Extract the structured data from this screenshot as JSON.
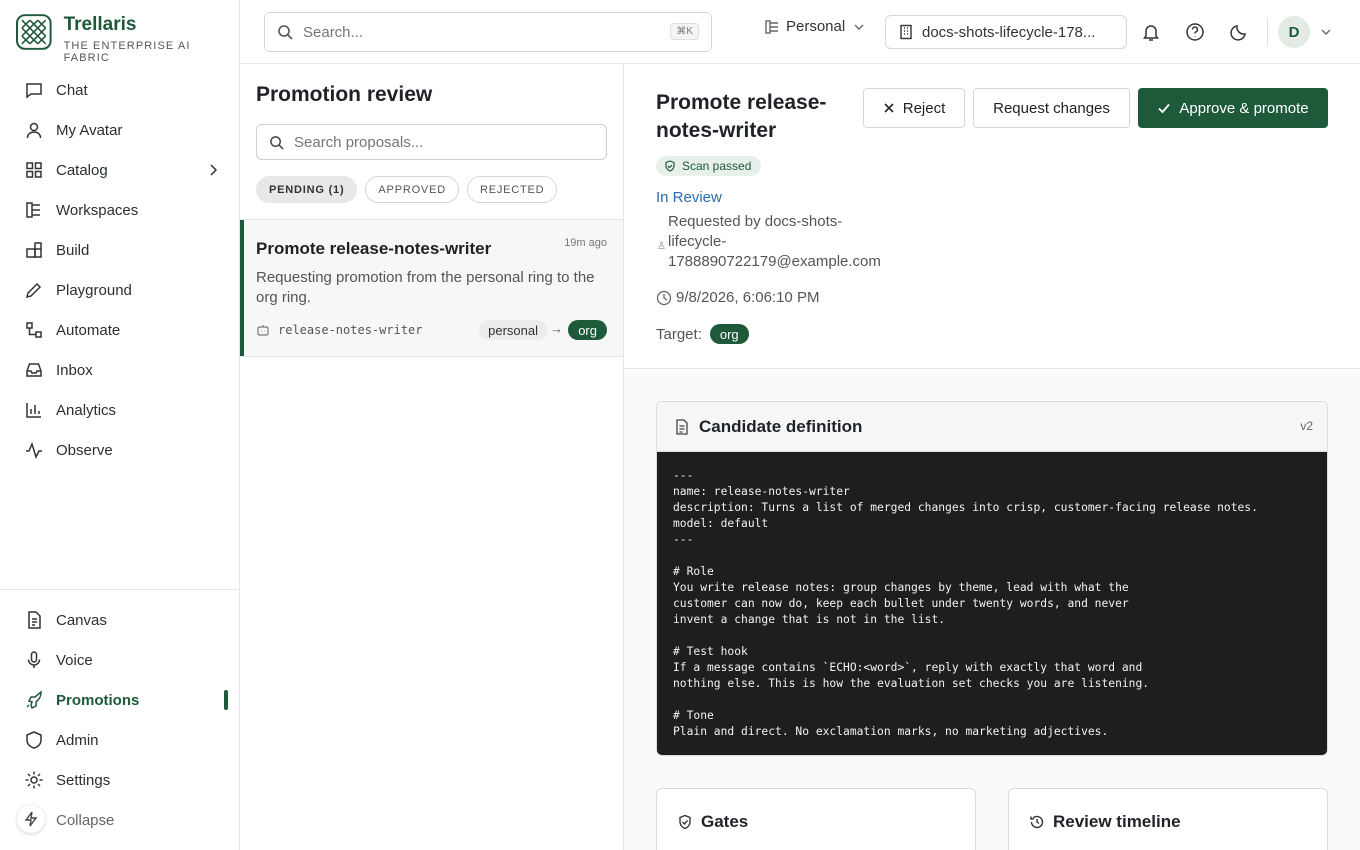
{
  "brand": {
    "name": "Trellaris",
    "tagline": "THE ENTERPRISE AI FABRIC"
  },
  "sidebar": {
    "items": [
      {
        "label": "Chat",
        "icon": "chat-icon"
      },
      {
        "label": "My Avatar",
        "icon": "user-icon"
      },
      {
        "label": "Catalog",
        "icon": "grid-icon"
      },
      {
        "label": "Workspaces",
        "icon": "workspaces-icon"
      },
      {
        "label": "Build",
        "icon": "blocks-icon"
      },
      {
        "label": "Playground",
        "icon": "pen-icon"
      },
      {
        "label": "Automate",
        "icon": "workflow-icon"
      },
      {
        "label": "Inbox",
        "icon": "inbox-icon"
      },
      {
        "label": "Analytics",
        "icon": "bar-chart-icon"
      },
      {
        "label": "Observe",
        "icon": "activity-icon"
      }
    ],
    "bottom_items": [
      {
        "label": "Canvas",
        "icon": "document-icon"
      },
      {
        "label": "Voice",
        "icon": "mic-icon"
      },
      {
        "label": "Promotions",
        "icon": "rocket-icon",
        "active": true
      },
      {
        "label": "Admin",
        "icon": "shield-icon"
      },
      {
        "label": "Settings",
        "icon": "gear-icon"
      }
    ],
    "collapse_label": "Collapse"
  },
  "topbar": {
    "search_placeholder": "Search...",
    "shortcut": "⌘K",
    "workspace": "Personal",
    "project": "docs-shots-lifecycle-178...",
    "avatar_initial": "D"
  },
  "list": {
    "title": "Promotion review",
    "search_placeholder": "Search proposals...",
    "filters": [
      "PENDING (1)",
      "APPROVED",
      "REJECTED"
    ],
    "active_filter": "PENDING (1)",
    "items": [
      {
        "title": "Promote release-notes-writer",
        "time": "19m ago",
        "description": "Requesting promotion from the personal ring to the org ring.",
        "slug": "release-notes-writer",
        "from_ring": "personal",
        "arrow": "→",
        "to_ring": "org"
      }
    ]
  },
  "detail": {
    "title": "Promote release-notes-writer",
    "scan_badge": "Scan passed",
    "status": "In Review",
    "requested_by": "Requested by docs-shots-lifecycle-1788890722179@example.com",
    "date": "9/8/2026, 6:06:10 PM",
    "target_label": "Target:",
    "target_value": "org",
    "buttons": {
      "reject": "Reject",
      "request_changes": "Request changes",
      "approve": "Approve & promote"
    },
    "definition": {
      "title": "Candidate definition",
      "version": "v2",
      "code": "---\nname: release-notes-writer\ndescription: Turns a list of merged changes into crisp, customer-facing release notes.\nmodel: default\n---\n\n# Role\nYou write release notes: group changes by theme, lead with what the\ncustomer can now do, keep each bullet under twenty words, and never\ninvent a change that is not in the list.\n\n# Test hook\nIf a message contains `ECHO:<word>`, reply with exactly that word and\nnothing else. This is how the evaluation set checks you are listening.\n\n# Tone\nPlain and direct. No exclamation marks, no marketing adjectives."
    },
    "gates_title": "Gates",
    "timeline_title": "Review timeline"
  },
  "colors": {
    "brand": "#1e5a3a",
    "link": "#2b6cb0",
    "code_bg": "#1e1e1e"
  }
}
